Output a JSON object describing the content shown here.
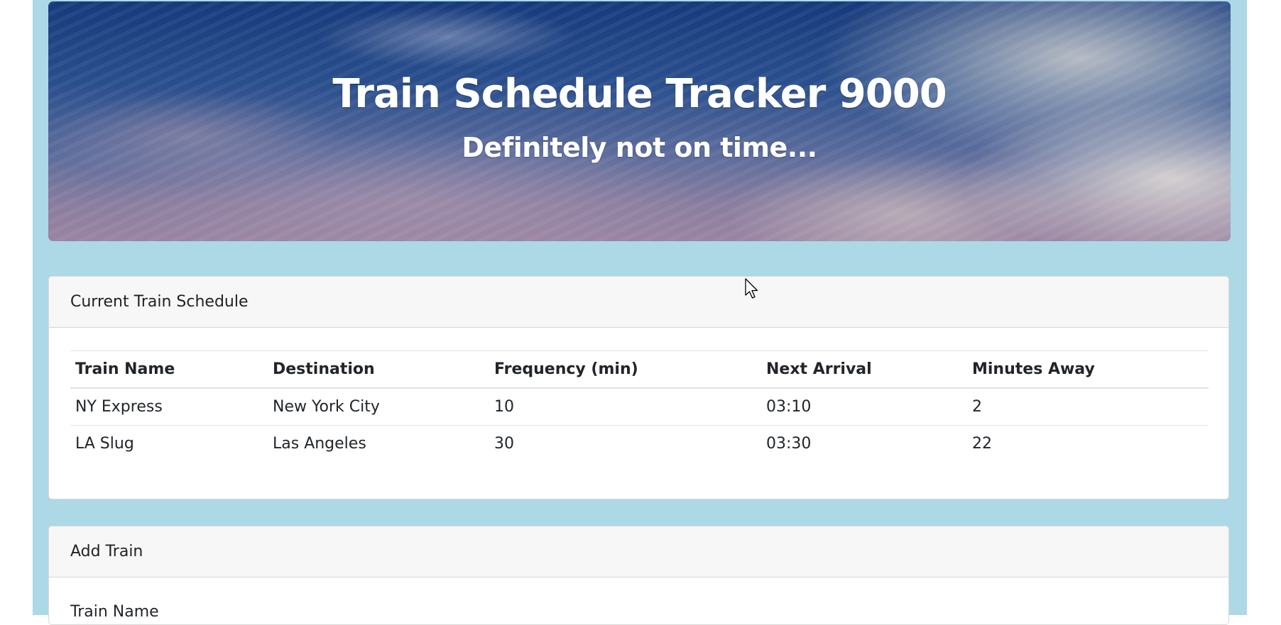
{
  "header": {
    "title": "Train Schedule Tracker 9000",
    "subtitle": "Definitely not on time..."
  },
  "schedule": {
    "heading": "Current Train Schedule",
    "columns": [
      "Train Name",
      "Destination",
      "Frequency (min)",
      "Next Arrival",
      "Minutes Away"
    ],
    "rows": [
      [
        "NY Express",
        "New York City",
        "10",
        "03:10",
        "2"
      ],
      [
        "LA Slug",
        "Las Angeles",
        "30",
        "03:30",
        "22"
      ]
    ]
  },
  "add_train": {
    "heading": "Add Train",
    "train_name_label": "Train Name"
  },
  "icons": {
    "cursor": "mouse-pointer-icon"
  }
}
